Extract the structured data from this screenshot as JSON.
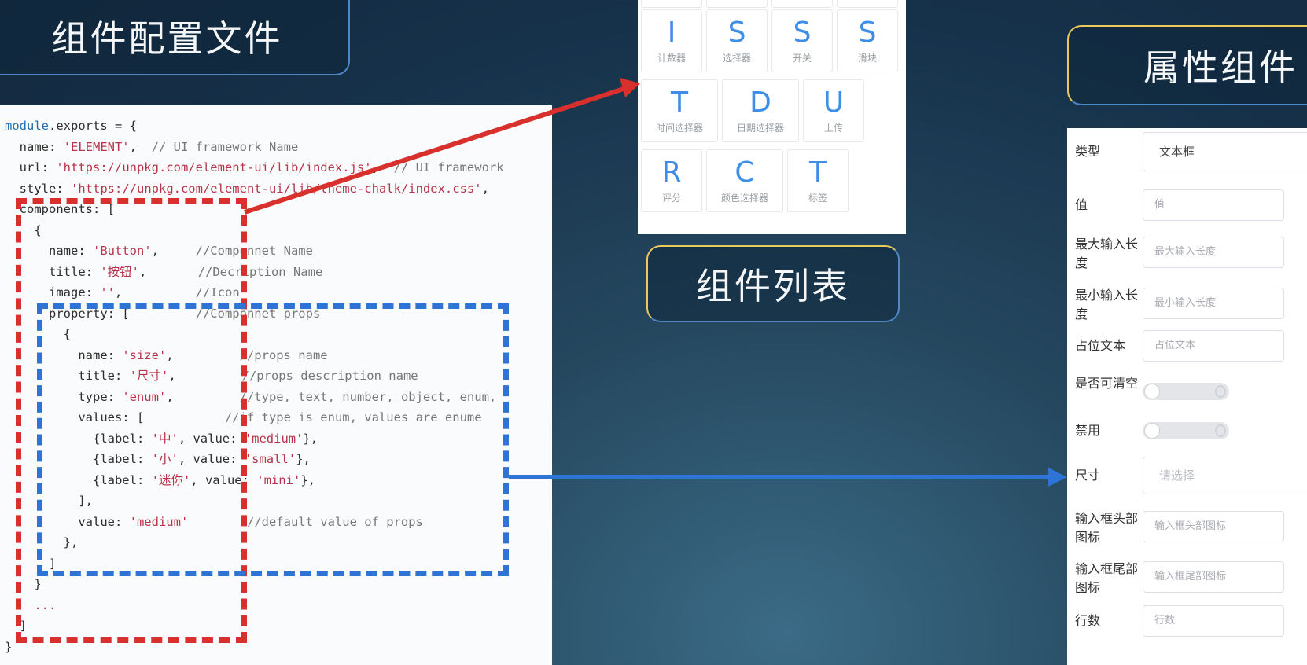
{
  "titles": {
    "config": "组件配置文件",
    "list": "组件列表",
    "property": "属性组件"
  },
  "code_lines": [
    [
      {
        "t": "module",
        "c": "c-k"
      },
      {
        "t": ".exports = {",
        "c": "c-p"
      }
    ],
    [
      {
        "t": "  name: ",
        "c": "c-p"
      },
      {
        "t": "'ELEMENT'",
        "c": "c-s"
      },
      {
        "t": ",  ",
        "c": "c-p"
      },
      {
        "t": "// UI framework Name",
        "c": "c-cm"
      }
    ],
    [
      {
        "t": "  url: ",
        "c": "c-p"
      },
      {
        "t": "'https://unpkg.com/element-ui/lib/index.js'",
        "c": "c-s"
      },
      {
        "t": ",  ",
        "c": "c-p"
      },
      {
        "t": "// UI framework",
        "c": "c-cm"
      }
    ],
    [
      {
        "t": "  style: ",
        "c": "c-p"
      },
      {
        "t": "'https://unpkg.com/element-ui/lib/theme-chalk/index.css'",
        "c": "c-s"
      },
      {
        "t": ",",
        "c": "c-p"
      }
    ],
    [
      {
        "t": "  components: [",
        "c": "c-p"
      }
    ],
    [
      {
        "t": "    {",
        "c": "c-p"
      }
    ],
    [
      {
        "t": "      name: ",
        "c": "c-p"
      },
      {
        "t": "'Button'",
        "c": "c-s"
      },
      {
        "t": ",     ",
        "c": "c-p"
      },
      {
        "t": "//Componnet Name",
        "c": "c-cm"
      }
    ],
    [
      {
        "t": "      title: ",
        "c": "c-p"
      },
      {
        "t": "'按钮'",
        "c": "c-s"
      },
      {
        "t": ",       ",
        "c": "c-p"
      },
      {
        "t": "//Decription Name",
        "c": "c-cm"
      }
    ],
    [
      {
        "t": "      image: ",
        "c": "c-p"
      },
      {
        "t": "''",
        "c": "c-s"
      },
      {
        "t": ",          ",
        "c": "c-p"
      },
      {
        "t": "//Icon",
        "c": "c-cm"
      }
    ],
    [
      {
        "t": "      property: [         ",
        "c": "c-p"
      },
      {
        "t": "//Componnet props",
        "c": "c-cm"
      }
    ],
    [
      {
        "t": "        {",
        "c": "c-p"
      }
    ],
    [
      {
        "t": "          name: ",
        "c": "c-p"
      },
      {
        "t": "'size'",
        "c": "c-s"
      },
      {
        "t": ",         ",
        "c": "c-p"
      },
      {
        "t": "//props name",
        "c": "c-cm"
      }
    ],
    [
      {
        "t": "          title: ",
        "c": "c-p"
      },
      {
        "t": "'尺寸'",
        "c": "c-s"
      },
      {
        "t": ",         ",
        "c": "c-p"
      },
      {
        "t": "//props description name",
        "c": "c-cm"
      }
    ],
    [
      {
        "t": "          type: ",
        "c": "c-p"
      },
      {
        "t": "'enum'",
        "c": "c-s"
      },
      {
        "t": ",         ",
        "c": "c-p"
      },
      {
        "t": "//type, text, number, object, enum,",
        "c": "c-cm"
      }
    ],
    [
      {
        "t": "          values: [           ",
        "c": "c-p"
      },
      {
        "t": "//if type is enum, values are enume",
        "c": "c-cm"
      }
    ],
    [
      {
        "t": "            {label: ",
        "c": "c-p"
      },
      {
        "t": "'中'",
        "c": "c-s"
      },
      {
        "t": ", value: ",
        "c": "c-p"
      },
      {
        "t": "'medium'",
        "c": "c-s"
      },
      {
        "t": "},",
        "c": "c-p"
      }
    ],
    [
      {
        "t": "            {label: ",
        "c": "c-p"
      },
      {
        "t": "'小'",
        "c": "c-s"
      },
      {
        "t": ", value: ",
        "c": "c-p"
      },
      {
        "t": "'small'",
        "c": "c-s"
      },
      {
        "t": "},",
        "c": "c-p"
      }
    ],
    [
      {
        "t": "            {label: ",
        "c": "c-p"
      },
      {
        "t": "'迷你'",
        "c": "c-s"
      },
      {
        "t": ", value: ",
        "c": "c-p"
      },
      {
        "t": "'mini'",
        "c": "c-s"
      },
      {
        "t": "},",
        "c": "c-p"
      }
    ],
    [
      {
        "t": "          ],",
        "c": "c-p"
      }
    ],
    [
      {
        "t": "          value: ",
        "c": "c-p"
      },
      {
        "t": "'medium'",
        "c": "c-s"
      },
      {
        "t": "        ",
        "c": "c-p"
      },
      {
        "t": "//default value of props",
        "c": "c-cm"
      }
    ],
    [
      {
        "t": "        },",
        "c": "c-p"
      }
    ],
    [
      {
        "t": "      ]",
        "c": "c-p"
      }
    ],
    [
      {
        "t": "    }",
        "c": "c-p"
      }
    ],
    [
      {
        "t": "    ...",
        "c": "c-s"
      }
    ],
    [
      {
        "t": "  ]",
        "c": "c-p"
      }
    ],
    [
      {
        "t": "}",
        "c": "c-p"
      }
    ]
  ],
  "components": [
    {
      "letter": "I",
      "label": "计数器"
    },
    {
      "letter": "S",
      "label": "选择器"
    },
    {
      "letter": "S",
      "label": "开关"
    },
    {
      "letter": "S",
      "label": "滑块"
    },
    {
      "letter": "T",
      "label": "时间选择器"
    },
    {
      "letter": "D",
      "label": "日期选择器"
    },
    {
      "letter": "U",
      "label": "上传"
    },
    {
      "letter": "R",
      "label": "评分"
    },
    {
      "letter": "C",
      "label": "颜色选择器"
    },
    {
      "letter": "T",
      "label": "标签"
    }
  ],
  "properties": [
    {
      "label": "类型",
      "kind": "wide",
      "value": "文本框"
    },
    {
      "label": "值",
      "kind": "input",
      "value": "值"
    },
    {
      "label": "最大输入长度",
      "kind": "input",
      "value": "最大输入长度"
    },
    {
      "label": "最小输入长度",
      "kind": "input",
      "value": "最小输入长度"
    },
    {
      "label": "占位文本",
      "kind": "input",
      "value": "占位文本"
    },
    {
      "label": "是否可清空",
      "kind": "toggle",
      "value": ""
    },
    {
      "label": "禁用",
      "kind": "toggle",
      "value": ""
    },
    {
      "label": "尺寸",
      "kind": "select",
      "value": "请选择"
    },
    {
      "label": "输入框头部图标",
      "kind": "input",
      "value": "输入框头部图标"
    },
    {
      "label": "输入框尾部图标",
      "kind": "input",
      "value": "输入框尾部图标"
    },
    {
      "label": "行数",
      "kind": "input",
      "value": "行数"
    }
  ],
  "colors": {
    "red_arrow": "#d8302c",
    "blue_arrow": "#2e74d6",
    "accent": "#3d8ee6"
  }
}
